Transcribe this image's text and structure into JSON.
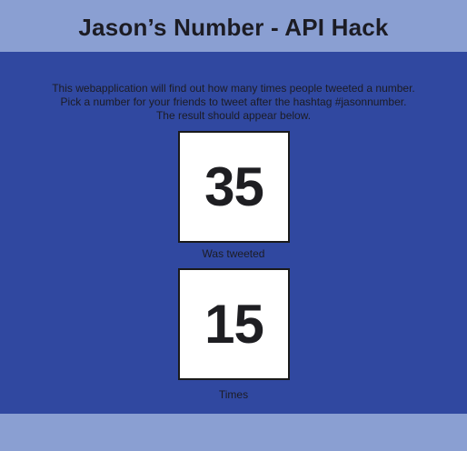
{
  "header": {
    "title": "Jason’s Number - API Hack"
  },
  "intro": {
    "lines": [
      "This webapplication will find out how many times people tweeted a number.",
      "Pick a number for your friends to tweet after the hashtag #jasonnumber.",
      "The result should appear below."
    ]
  },
  "result": {
    "number": "35",
    "number_caption": "Was tweeted",
    "count": "15",
    "count_caption": "Times"
  },
  "colors": {
    "header_bg": "#8a9fd2",
    "page_bg": "#3048a0",
    "box_bg": "#ffffff",
    "text": "#1c1c24"
  }
}
